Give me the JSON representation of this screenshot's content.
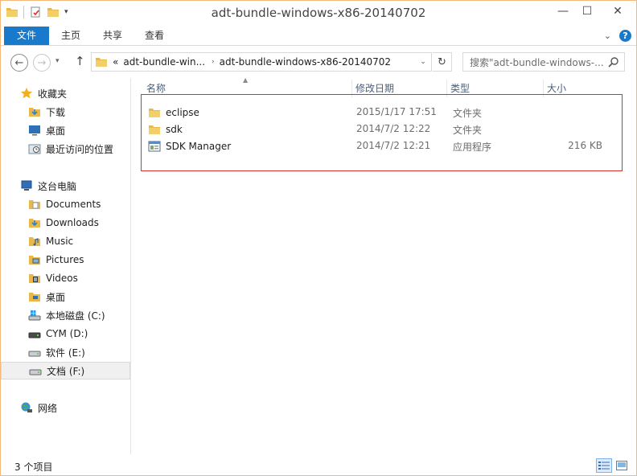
{
  "window": {
    "title": "adt-bundle-windows-x86-20140702"
  },
  "ribbon": {
    "tabs": [
      {
        "label": "文件"
      },
      {
        "label": "主页"
      },
      {
        "label": "共享"
      },
      {
        "label": "查看"
      }
    ]
  },
  "address": {
    "overflow": "«",
    "crumbs": [
      "adt-bundle-win...",
      "adt-bundle-windows-x86-20140702"
    ]
  },
  "search": {
    "placeholder": "搜索\"adt-bundle-windows-..."
  },
  "nav": {
    "favorites": {
      "label": "收藏夹",
      "items": [
        "下载",
        "桌面",
        "最近访问的位置"
      ]
    },
    "thispc": {
      "label": "这台电脑",
      "items": [
        "Documents",
        "Downloads",
        "Music",
        "Pictures",
        "Videos",
        "桌面",
        "本地磁盘 (C:)",
        "CYM (D:)",
        "软件 (E:)",
        "文档 (F:)"
      ]
    },
    "network": {
      "label": "网络"
    }
  },
  "columns": [
    "名称",
    "修改日期",
    "类型",
    "大小"
  ],
  "files": [
    {
      "name": "eclipse",
      "date": "2015/1/17 17:51",
      "type": "文件夹",
      "size": ""
    },
    {
      "name": "sdk",
      "date": "2014/7/2 12:22",
      "type": "文件夹",
      "size": ""
    },
    {
      "name": "SDK Manager",
      "date": "2014/7/2 12:21",
      "type": "应用程序",
      "size": "216 KB"
    }
  ],
  "status": {
    "count_text": "3 个项目"
  },
  "colors": {
    "accent": "#1979ca",
    "highlight_border": "#d9302c",
    "header_text": "#4c607a"
  }
}
